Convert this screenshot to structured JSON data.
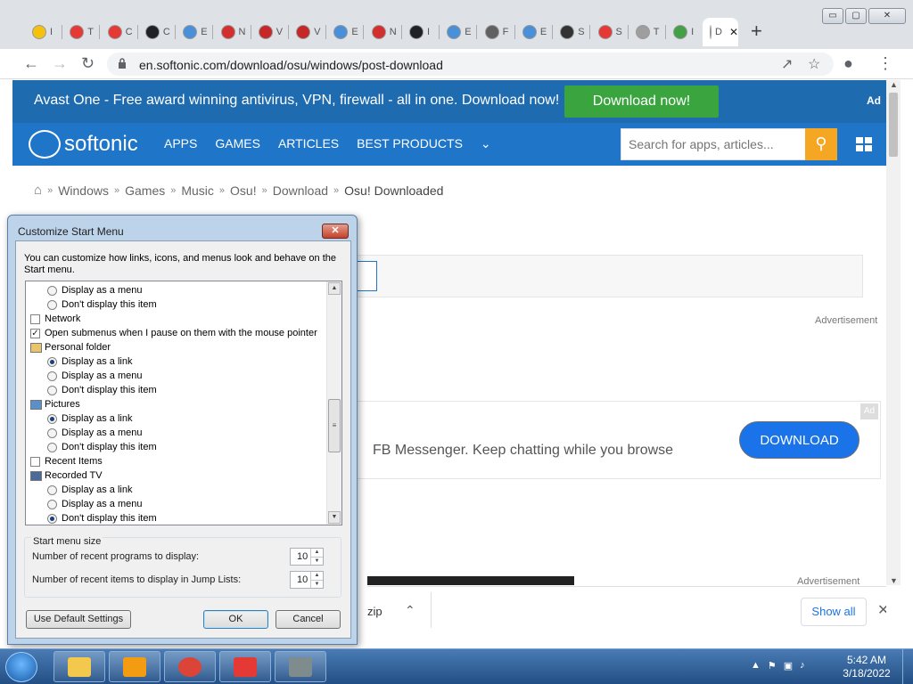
{
  "browser": {
    "url": "en.softonic.com/download/osu/windows/post-download",
    "tabs": [
      {
        "letter": "I",
        "color": "#f4c20d"
      },
      {
        "letter": "T",
        "color": "#e53935"
      },
      {
        "letter": "C",
        "color": "#e53935"
      },
      {
        "letter": "C",
        "color": "#202124"
      },
      {
        "letter": "E",
        "color": "#4a90d9"
      },
      {
        "letter": "N",
        "color": "#d32f2f"
      },
      {
        "letter": "V",
        "color": "#c62828"
      },
      {
        "letter": "V",
        "color": "#c62828"
      },
      {
        "letter": "E",
        "color": "#4a90d9"
      },
      {
        "letter": "N",
        "color": "#d32f2f"
      },
      {
        "letter": "I",
        "color": "#202124"
      },
      {
        "letter": "E",
        "color": "#4a90d9"
      },
      {
        "letter": "F",
        "color": "#616161"
      },
      {
        "letter": "E",
        "color": "#4a90d9"
      },
      {
        "letter": "S",
        "color": "#333333"
      },
      {
        "letter": "S",
        "color": "#e53935"
      },
      {
        "letter": "T",
        "color": "#9e9e9e"
      },
      {
        "letter": "I",
        "color": "#43a047"
      },
      {
        "letter": "D",
        "color": "#ffffff"
      }
    ],
    "win_controls": {
      "min": "▭",
      "max": "▢",
      "close": "✕"
    },
    "new_tab": "+"
  },
  "page": {
    "ad_banner": {
      "text": "Avast One - Free award winning antivirus, VPN, firewall - all in one. Download now!",
      "button": "Download now!",
      "ad_label": "Ad"
    },
    "nav": {
      "logo": "softonic",
      "menu": [
        "APPS",
        "GAMES",
        "ARTICLES",
        "BEST PRODUCTS"
      ],
      "search_placeholder": "Search for apps, articles..."
    },
    "breadcrumb": [
      "Windows",
      "Games",
      "Music",
      "Osu!",
      "Download"
    ],
    "breadcrumb_current": "Osu! Downloaded",
    "advertisement_label": "Advertisement",
    "messenger_ad": {
      "text": "FB Messenger. Keep chatting while you browse",
      "button": "DOWNLOAD",
      "ad_badge": "Ad"
    },
    "download_bar": {
      "file": "zip",
      "show_all": "Show all"
    }
  },
  "dialog": {
    "title": "Customize Start Menu",
    "description": "You can customize how links, icons, and menus look and behave on the Start menu.",
    "items": [
      {
        "type": "radio",
        "indent": true,
        "label": "Display as a menu",
        "checked": false
      },
      {
        "type": "radio",
        "indent": true,
        "label": "Don't display this item",
        "checked": false
      },
      {
        "type": "check",
        "indent": false,
        "label": "Network",
        "checked": false
      },
      {
        "type": "check",
        "indent": false,
        "label": "Open submenus when I pause on them with the mouse pointer",
        "checked": true
      },
      {
        "type": "folder",
        "indent": false,
        "label": "Personal folder"
      },
      {
        "type": "radio",
        "indent": true,
        "label": "Display as a link",
        "checked": true
      },
      {
        "type": "radio",
        "indent": true,
        "label": "Display as a menu",
        "checked": false
      },
      {
        "type": "radio",
        "indent": true,
        "label": "Don't display this item",
        "checked": false
      },
      {
        "type": "pictures",
        "indent": false,
        "label": "Pictures"
      },
      {
        "type": "radio",
        "indent": true,
        "label": "Display as a link",
        "checked": true
      },
      {
        "type": "radio",
        "indent": true,
        "label": "Display as a menu",
        "checked": false
      },
      {
        "type": "radio",
        "indent": true,
        "label": "Don't display this item",
        "checked": false
      },
      {
        "type": "check",
        "indent": false,
        "label": "Recent Items",
        "checked": false
      },
      {
        "type": "tv",
        "indent": false,
        "label": "Recorded TV"
      },
      {
        "type": "radio",
        "indent": true,
        "label": "Display as a link",
        "checked": false
      },
      {
        "type": "radio",
        "indent": true,
        "label": "Display as a menu",
        "checked": false
      },
      {
        "type": "radio",
        "indent": true,
        "label": "Don't display this item",
        "checked": true
      }
    ],
    "size_group": {
      "title": "Start menu size",
      "recent_programs_label": "Number of recent programs to display:",
      "recent_programs_value": "10",
      "jump_list_label": "Number of recent items to display in Jump Lists:",
      "jump_list_value": "10"
    },
    "buttons": {
      "defaults": "Use Default Settings",
      "ok": "OK",
      "cancel": "Cancel"
    }
  },
  "taskbar": {
    "apps": [
      {
        "name": "explorer",
        "color": "#f2c94c"
      },
      {
        "name": "media-player",
        "color": "#f39c12"
      },
      {
        "name": "chrome",
        "color": "#db4437"
      },
      {
        "name": "wps",
        "color": "#e53935"
      },
      {
        "name": "installer",
        "color": "#7f8c8d"
      }
    ],
    "clock_time": "5:42 AM",
    "clock_date": "3/18/2022"
  }
}
